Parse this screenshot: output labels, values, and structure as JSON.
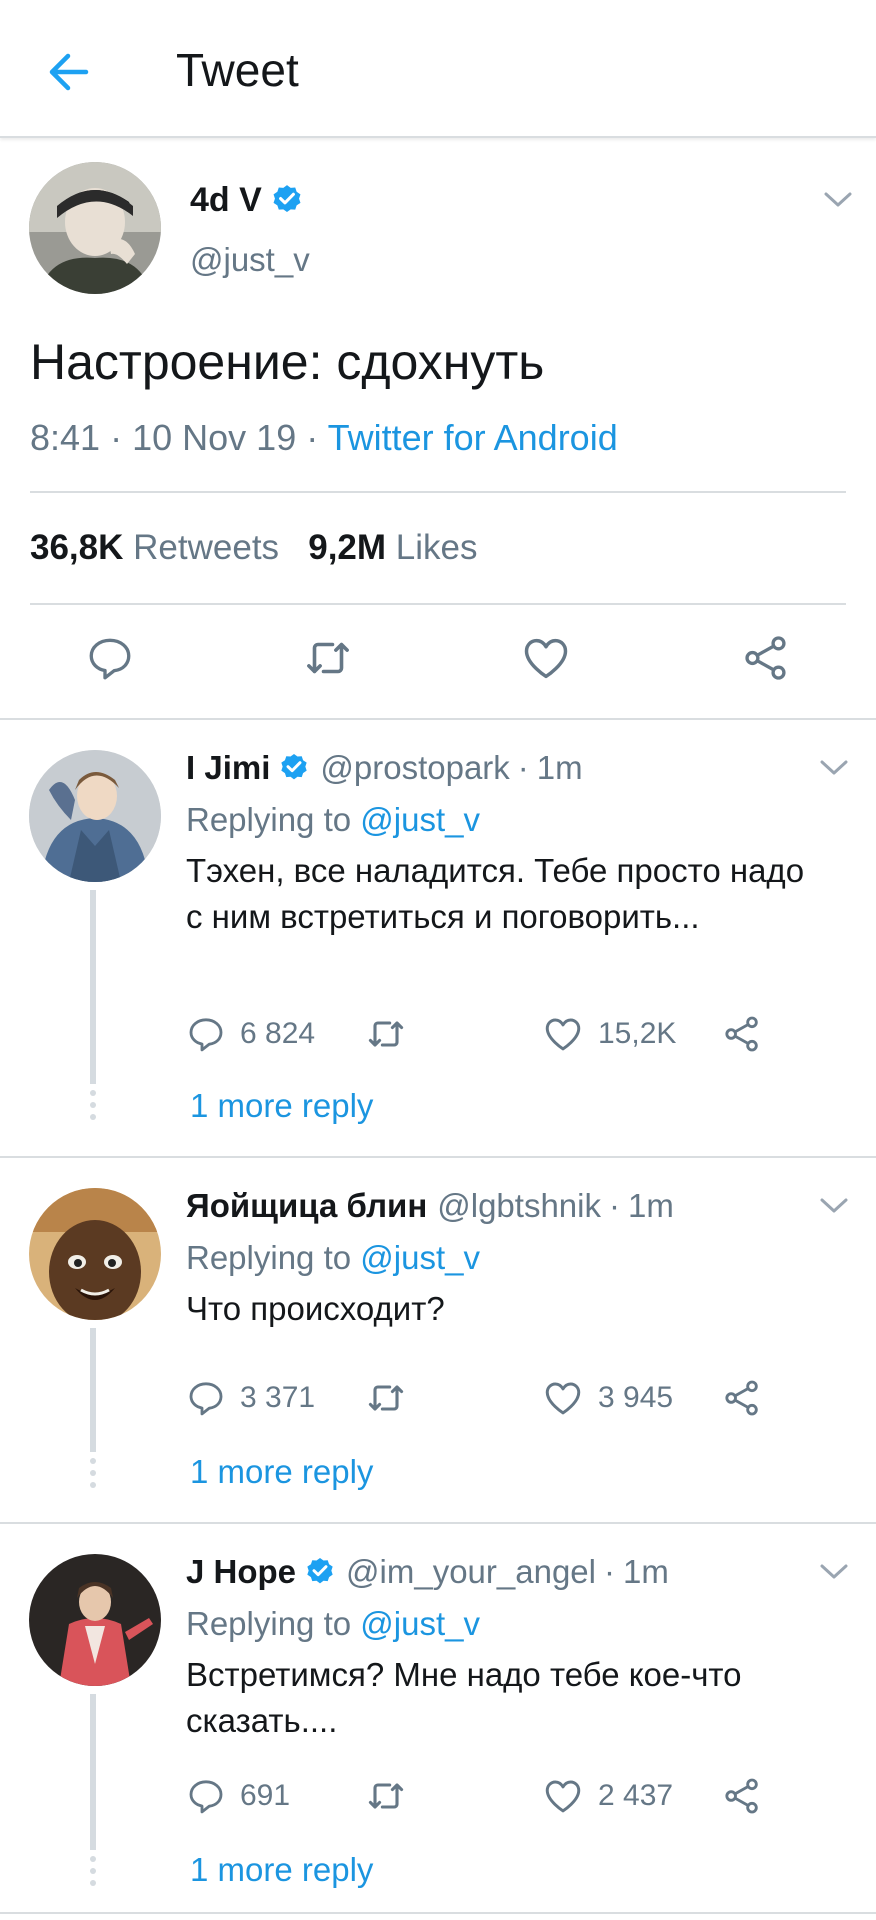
{
  "header": {
    "title": "Tweet"
  },
  "main_tweet": {
    "name": "4d V",
    "handle": "@just_v",
    "text": "Настроение: сдохнуть",
    "time": "8:41",
    "date": "10 Nov 19",
    "separator": "·",
    "source": "Twitter for Android",
    "retweets_count": "36,8K",
    "retweets_label": "Retweets",
    "likes_count": "9,2M",
    "likes_label": "Likes"
  },
  "replies": [
    {
      "name": "I Jimi",
      "verified": true,
      "handle": "@prostopark",
      "time": "1m",
      "replying_label": "Replying to",
      "replying_to": "@just_v",
      "text": "Тэхен, все наладится. Тебе просто надо с ним встретиться и поговорить...",
      "replies_count": "6 824",
      "likes_count": "15,2K",
      "more_reply": "1 more reply"
    },
    {
      "name": "Яойщица блин",
      "verified": false,
      "handle": "@lgbtshnik",
      "time": "1m",
      "replying_label": "Replying to",
      "replying_to": "@just_v",
      "text": "Что происходит?",
      "replies_count": "3 371",
      "likes_count": "3 945",
      "more_reply": "1 more reply"
    },
    {
      "name": "J Hope",
      "verified": true,
      "handle": "@im_your_angel",
      "time": "1m",
      "replying_label": "Replying to",
      "replying_to": "@just_v",
      "text": "Встретимся? Мне надо тебе кое-что сказать....",
      "replies_count": "691",
      "likes_count": "2 437",
      "more_reply": "1 more reply"
    }
  ],
  "colors": {
    "accent": "#1b95e0",
    "text_primary": "#14171a",
    "text_secondary": "#657786",
    "divider": "#d9dde0"
  },
  "icons": {
    "back": "arrow-left-icon",
    "verified": "verified-badge-icon",
    "caret": "chevron-down-icon",
    "reply": "comment-icon",
    "retweet": "retweet-icon",
    "like": "heart-icon",
    "share": "share-icon"
  }
}
